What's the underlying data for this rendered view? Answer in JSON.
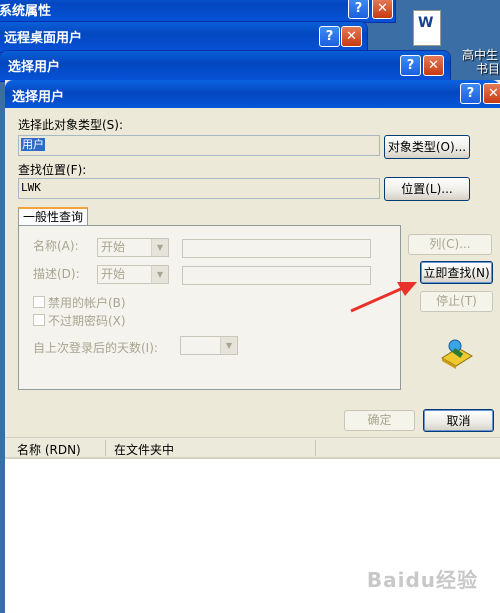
{
  "background_windows": [
    {
      "title": "系统属性"
    },
    {
      "title": "远程桌面用户"
    },
    {
      "title": "选择用户"
    }
  ],
  "desktop_icon": {
    "label_line1": "高中生",
    "label_line2": "书目",
    "glyph": "W"
  },
  "dialog": {
    "title": "选择用户",
    "object_type_label": "选择此对象类型(S):",
    "object_type_value": "用户",
    "object_type_button": "对象类型(O)...",
    "location_label": "查找位置(F):",
    "location_value": "LWK",
    "location_button": "位置(L)...",
    "tab_label": "一般性查询",
    "name_label": "名称(A):",
    "name_combo": "开始",
    "desc_label": "描述(D):",
    "desc_combo": "开始",
    "disabled_accounts": "禁用的帐户(B)",
    "no_expire_pwd": "不过期密码(X)",
    "days_since_login": "自上次登录后的天数(I):",
    "columns_button": "列(C)...",
    "find_now_button": "立即查找(N)",
    "stop_button": "停止(T)",
    "ok_button": "确定",
    "cancel_button": "取消",
    "results_columns": [
      "名称 (RDN)",
      "在文件夹中"
    ]
  },
  "watermark": "Baidu经验",
  "colors": {
    "titlebar": "#0447c0",
    "dialog_bg": "#ece9d8",
    "arrow": "#e8322a"
  }
}
